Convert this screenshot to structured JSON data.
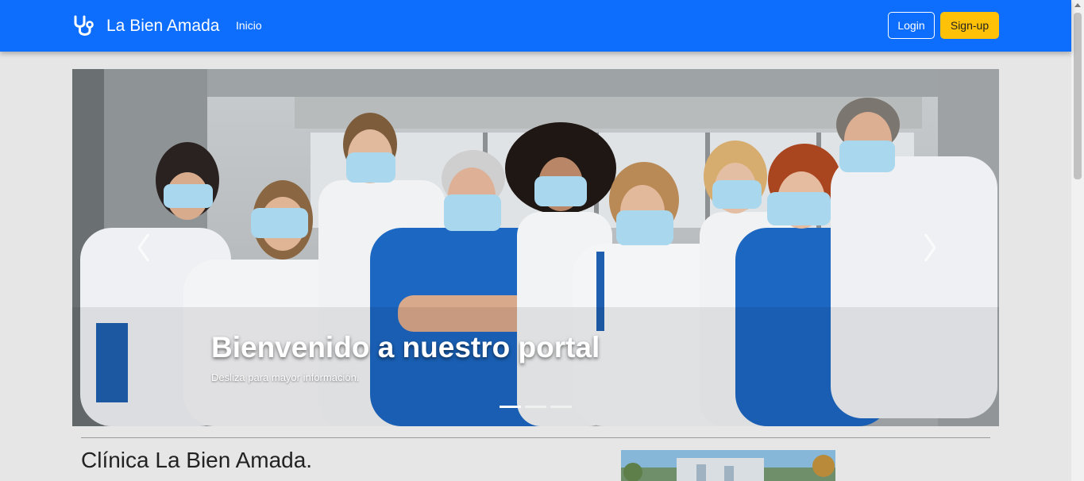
{
  "navbar": {
    "brand_name": "La Bien Amada",
    "brand_icon": "stethoscope-icon",
    "links": [
      "Inicio"
    ],
    "login_label": "Login",
    "signup_label": "Sign-up",
    "bg_color": "#0d6efd",
    "signup_color": "#ffc107"
  },
  "carousel": {
    "caption_title": "Bienvenido a nuestro portal",
    "caption_subtitle": "Desliza para mayor información.",
    "slide_count": 3,
    "active_slide": 1,
    "prev_icon": "chevron-left-icon",
    "next_icon": "chevron-right-icon"
  },
  "section": {
    "title": "Clínica La Bien Amada."
  }
}
